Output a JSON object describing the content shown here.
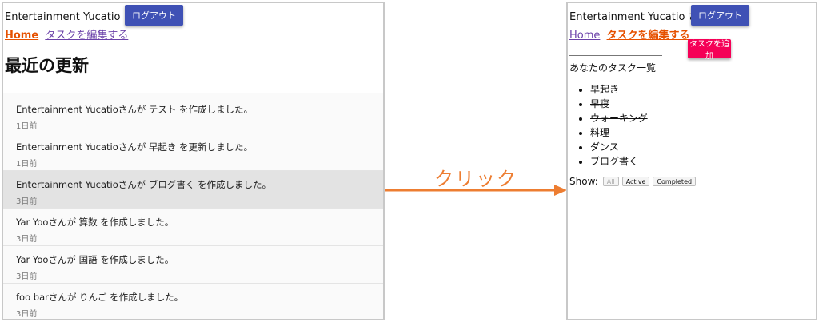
{
  "left": {
    "user_line": "Entertainment Yucatio さん",
    "logout_label": "ログアウト",
    "nav_home": "Home",
    "nav_edit": "タスクを編集する",
    "page_title": "最近の更新",
    "updates": [
      {
        "text": "Entertainment Yucatioさんが テスト を作成しました。",
        "time": "1日前"
      },
      {
        "text": "Entertainment Yucatioさんが 早起き を更新しました。",
        "time": "1日前"
      },
      {
        "text": "Entertainment Yucatioさんが ブログ書く を作成しました。",
        "time": "3日前"
      },
      {
        "text": "Yar Yooさんが 算数 を作成しました。",
        "time": "3日前"
      },
      {
        "text": "Yar Yooさんが 国語 を作成しました。",
        "time": "3日前"
      },
      {
        "text": "foo barさんが りんご を作成しました。",
        "time": "3日前"
      }
    ]
  },
  "arrow": {
    "label": "クリック",
    "color": "#ed7d31"
  },
  "right": {
    "user_line": "Entertainment Yucatio さん",
    "logout_label": "ログアウト",
    "nav_home": "Home",
    "nav_edit": "タスクを編集する",
    "add_label": "タスクを追加",
    "list_title": "あなたのタスク一覧",
    "tasks": [
      {
        "label": "早起き",
        "done": false
      },
      {
        "label": "早寝",
        "done": true
      },
      {
        "label": "ウォーキング",
        "done": true
      },
      {
        "label": "料理",
        "done": false
      },
      {
        "label": "ダンス",
        "done": false
      },
      {
        "label": "ブログ書く",
        "done": false
      }
    ],
    "show_label": "Show:",
    "filters": [
      "All",
      "Active",
      "Completed"
    ]
  },
  "colors": {
    "primary": "#3f51b5",
    "accent": "#f50057",
    "link_active": "#e65100",
    "link_visited": "#6a40a8"
  }
}
